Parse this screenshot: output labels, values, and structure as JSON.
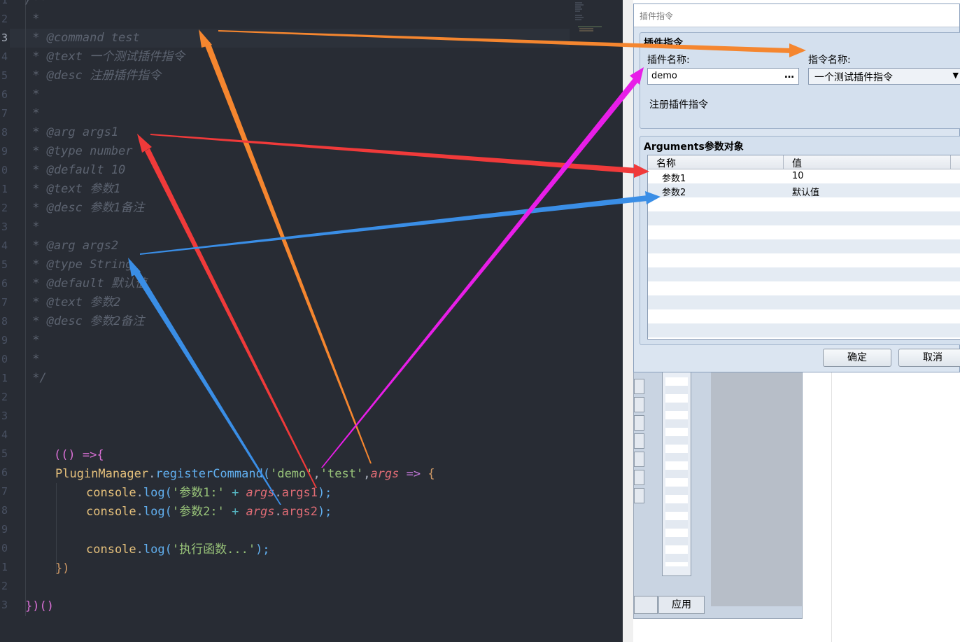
{
  "editor": {
    "line_numbers": [
      "1",
      "2",
      "3",
      "4",
      "5",
      "6",
      "7",
      "8",
      "9",
      "0",
      "1",
      "2",
      "3",
      "4",
      "5",
      "6",
      "7",
      "8",
      "9",
      "0",
      "1",
      "2",
      "3",
      "4",
      "5",
      "6",
      "7",
      "8",
      "9",
      "0",
      "1",
      "2",
      "3"
    ],
    "comment_lines": [
      "/**",
      " *",
      " * @command test",
      " * @text 一个测试插件指令",
      " * @desc 注册插件指令",
      " *",
      " *",
      " * @arg args1",
      " * @type number",
      " * @default 10",
      " * @text 参数1",
      " * @desc 参数1备注",
      " *",
      " * @arg args2",
      " * @type String",
      " * @default 默认值",
      " * @text 参数2",
      " * @desc 参数2备注",
      " *",
      " *",
      " */"
    ],
    "code": {
      "iife_open": "(() =>{",
      "l26": {
        "obj": "PluginManager",
        "dot": ".",
        "fn": "registerCommand",
        "p1": "(",
        "s1": "'demo'",
        "comma1": ",",
        "s2": "'test'",
        "comma2": ",",
        "arg": "args",
        "arrow": " => ",
        "brace": "{"
      },
      "l27": {
        "obj": "console",
        "dot": ".",
        "fn": "log",
        "p1": "(",
        "s": "'参数1:'",
        "plus": " + ",
        "v": "args",
        "dot2": ".",
        "prop": "args1",
        "end": ");"
      },
      "l28": {
        "obj": "console",
        "dot": ".",
        "fn": "log",
        "p1": "(",
        "s": "'参数2:'",
        "plus": " + ",
        "v": "args",
        "dot2": ".",
        "prop": "args2",
        "end": ");"
      },
      "l30": {
        "obj": "console",
        "dot": ".",
        "fn": "log",
        "p1": "(",
        "s": "'执行函数...'",
        "end": ");"
      },
      "l31": "})",
      "l33": "})()"
    }
  },
  "dialog": {
    "title": "插件指令",
    "group_title": "插件指令",
    "plugin_name_label": "插件名称:",
    "plugin_name_value": "demo",
    "plugin_name_button": "…",
    "command_name_label": "指令名称:",
    "command_name_value": "一个测试插件指令",
    "command_dropdown_arrow": "▼",
    "description": "注册插件指令",
    "args_group_title": "Arguments参数对象",
    "table_headers": [
      "名称",
      "值"
    ],
    "rows": [
      {
        "name": "参数1",
        "value": "10"
      },
      {
        "name": "参数2",
        "value": "默认值"
      }
    ],
    "ok_label": "确定",
    "cancel_label": "取消"
  },
  "background_window": {
    "apply_label": "应用"
  },
  "colors": {
    "orange": "#f5862f",
    "red": "#f03a3a",
    "blue": "#3a8ee6",
    "magenta": "#e81ee8"
  }
}
